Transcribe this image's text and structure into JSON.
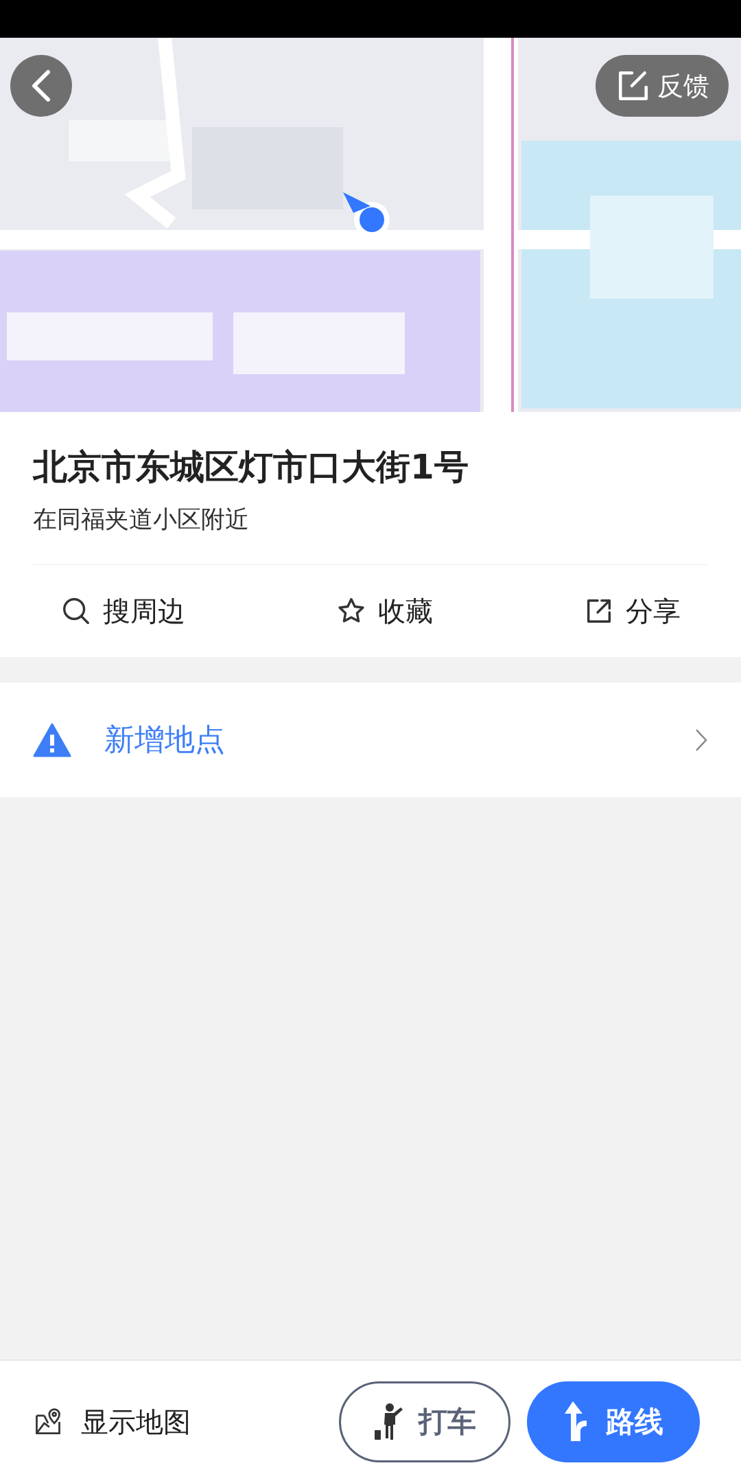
{
  "feedback_button": {
    "label": "反馈"
  },
  "place": {
    "title": "北京市东城区灯市口大街1号",
    "subtitle": "在同福夹道小区附近"
  },
  "actions": [
    {
      "kind": "search",
      "label": "搜周边"
    },
    {
      "kind": "star",
      "label": "收藏"
    },
    {
      "kind": "share",
      "label": "分享"
    }
  ],
  "report_row": {
    "label": "新增地点"
  },
  "bottom_bar": {
    "show_map": "显示地图",
    "taxi": "打车",
    "route": "路线"
  }
}
